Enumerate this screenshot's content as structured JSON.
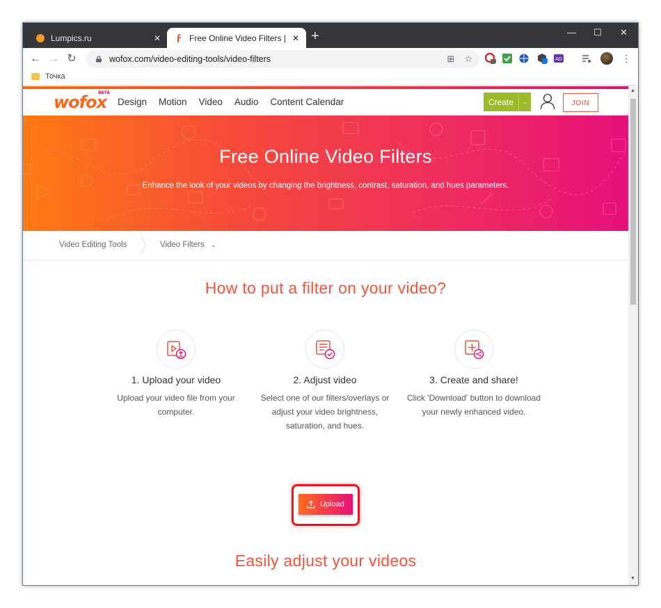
{
  "browser": {
    "tabs": [
      {
        "title": "Lumpics.ru",
        "active": false,
        "favicon": "orange-circle-icon"
      },
      {
        "title": "Free Online Video Filters | WoFox",
        "active": true,
        "favicon": "wofox-f-icon"
      }
    ],
    "new_tab": "+",
    "window_controls": {
      "minimize": "—",
      "maximize": "☐",
      "close": "✕"
    },
    "url": "wofox.com/video-editing-tools/video-filters",
    "bookmarks": [
      {
        "label": "Точка",
        "icon": "folder-icon"
      }
    ],
    "extensions": [
      "opera-ext-icon",
      "check-ext-icon",
      "globe-ext-icon",
      "box-ext-icon",
      "ad-ext-icon",
      "playlist-icon"
    ],
    "extension_badges": {
      "opera": "4",
      "box": "1"
    },
    "colors": {
      "tabbar": "#35363a",
      "omnibox": "#f1f3f4"
    }
  },
  "site": {
    "logo": "wofox",
    "logo_badge": "BETA",
    "nav": [
      "Design",
      "Motion",
      "Video",
      "Audio",
      "Content Calendar"
    ],
    "create_label": "Create",
    "join_label": "JOIN",
    "colors": {
      "brand_orange": "#f26a21",
      "brand_pink": "#e6107a",
      "create_green": "#9cba2b"
    }
  },
  "hero": {
    "title": "Free Online Video Filters",
    "subtitle": "Enhance the look of your videos by changing the brightness, contrast, saturation, and hues parameters."
  },
  "breadcrumb": {
    "items": [
      "Video Editing Tools",
      "Video Filters"
    ]
  },
  "how": {
    "title": "How to put a filter on your video?",
    "steps": [
      {
        "title": "1. Upload your video",
        "desc": "Upload your video file from your computer.",
        "icon": "upload-video-icon"
      },
      {
        "title": "2. Adjust video",
        "desc": "Select one of our filters/overlays or adjust your video brightness, saturation, and hues.",
        "icon": "adjust-checklist-icon"
      },
      {
        "title": "3. Create and share!",
        "desc": "Click 'Download' button to download your newly enhanced video.",
        "icon": "create-share-icon"
      }
    ],
    "upload_label": "Upload"
  },
  "easy": {
    "title": "Easily adjust your videos"
  }
}
